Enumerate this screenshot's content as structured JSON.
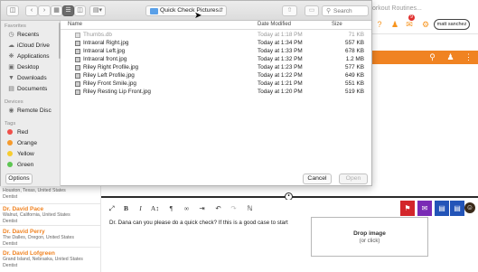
{
  "background": {
    "topbar": {
      "workout_text": "orkout Routines...",
      "user_button": "matt sanchez",
      "badge_count": "9",
      "orange_color": "#f08322"
    },
    "sidebar": {
      "entries": [
        {
          "name": "",
          "location": "Houston, Texas, United States",
          "role": "Dentist"
        },
        {
          "name": "Dr. David Pace",
          "location": "Walnut, California, United States",
          "role": "Dentist"
        },
        {
          "name": "Dr. David Perry",
          "location": "The Dalles, Oregon, United States",
          "role": "Dentist"
        },
        {
          "name": "Dr. David Lofgreen",
          "location": "Grand Island, Nebraska, United States",
          "role": "Dentist"
        }
      ]
    },
    "editor": {
      "message": "Dr. Dana can you please do a quick check? If this is a good case to start",
      "drop_title": "Drop image",
      "drop_sub": "(or click)"
    }
  },
  "dialog": {
    "current_folder": "Quick Check Pictures",
    "search_placeholder": "Search",
    "sidebar": {
      "favorites_label": "Favorites",
      "favorites": [
        {
          "label": "Recents",
          "icon": "clock-icon"
        },
        {
          "label": "iCloud Drive",
          "icon": "cloud-icon"
        },
        {
          "label": "Applications",
          "icon": "applications-icon"
        },
        {
          "label": "Desktop",
          "icon": "desktop-icon"
        },
        {
          "label": "Downloads",
          "icon": "downloads-icon"
        },
        {
          "label": "Documents",
          "icon": "documents-icon"
        }
      ],
      "devices_label": "Devices",
      "devices": [
        {
          "label": "Remote Disc",
          "icon": "disc-icon"
        }
      ],
      "tags_label": "Tags",
      "tags": [
        {
          "label": "Red",
          "color": "#f0504a"
        },
        {
          "label": "Orange",
          "color": "#f59a2c"
        },
        {
          "label": "Yellow",
          "color": "#f7cc2e"
        },
        {
          "label": "Green",
          "color": "#5dc552"
        }
      ]
    },
    "columns": {
      "name": "Name",
      "date": "Date Modified",
      "size": "Size"
    },
    "files": [
      {
        "name": "Thumbs.db",
        "date": "Today at 1:18 PM",
        "size": "71 KB",
        "dim": true
      },
      {
        "name": "Intraoral Right.jpg",
        "date": "Today at 1:34 PM",
        "size": "557 KB",
        "dim": false
      },
      {
        "name": "Intraoral Left.jpg",
        "date": "Today at 1:33 PM",
        "size": "678 KB",
        "dim": false
      },
      {
        "name": "Intraoral front.jpg",
        "date": "Today at 1:32 PM",
        "size": "1.2 MB",
        "dim": false
      },
      {
        "name": "Riley Right Profile.jpg",
        "date": "Today at 1:23 PM",
        "size": "577 KB",
        "dim": false
      },
      {
        "name": "Riley Left Profile.jpg",
        "date": "Today at 1:22 PM",
        "size": "649 KB",
        "dim": false
      },
      {
        "name": "Riley Front Smile.jpg",
        "date": "Today at 1:21 PM",
        "size": "551 KB",
        "dim": false
      },
      {
        "name": "Riley Resting Lip Front.jpg",
        "date": "Today at 1:20 PM",
        "size": "519 KB",
        "dim": false
      }
    ],
    "buttons": {
      "options": "Options",
      "cancel": "Cancel",
      "open": "Open"
    }
  }
}
